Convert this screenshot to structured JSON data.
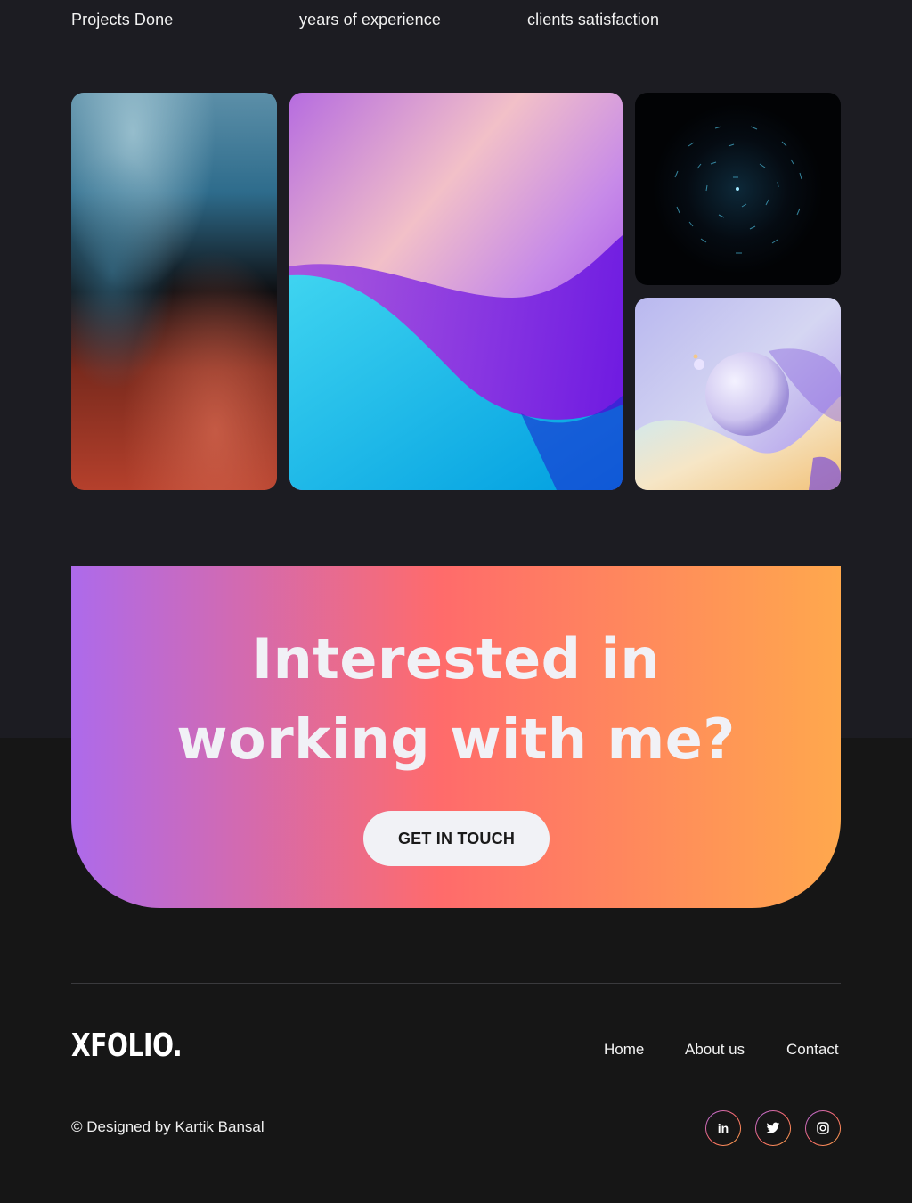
{
  "stats": {
    "projects_label": "Projects Done",
    "experience_label": "years of experience",
    "satisfaction_label": "clients satisfaction"
  },
  "gallery": {
    "images": [
      {
        "name": "fluid-art-blue-red"
      },
      {
        "name": "purple-blue-waves"
      },
      {
        "name": "dark-particle-sphere"
      },
      {
        "name": "pastel-3d-spheres"
      }
    ]
  },
  "cta": {
    "title_line1": "Interested in",
    "title_line2": "working with me?",
    "button_label": "GET IN TOUCH",
    "gradient": [
      "#ad6aeb",
      "#ff6b6b",
      "#ffa84d"
    ]
  },
  "footer": {
    "logo": "XFOLIO.",
    "nav": {
      "home": "Home",
      "about": "About us",
      "contact": "Contact"
    },
    "copyright": "© Designed by Kartik Bansal",
    "social": {
      "linkedin_icon": "in",
      "twitter_icon": "twitter-icon",
      "instagram_icon": "instagram-icon"
    }
  },
  "colors": {
    "background_top": "#1c1c22",
    "background_bottom": "#161616",
    "button_bg": "#f1f2f6"
  }
}
